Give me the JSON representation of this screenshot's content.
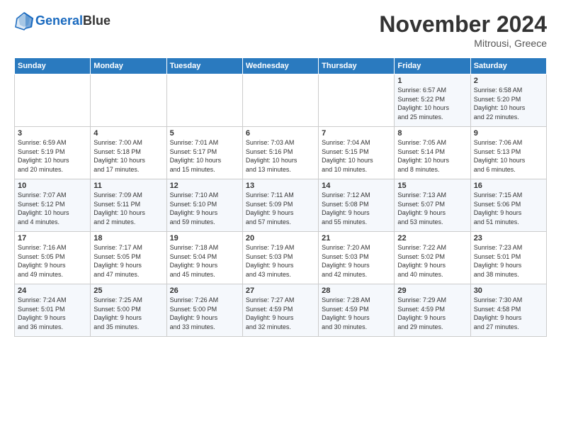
{
  "header": {
    "logo_line1": "General",
    "logo_line2": "Blue",
    "month": "November 2024",
    "location": "Mitrousi, Greece"
  },
  "weekdays": [
    "Sunday",
    "Monday",
    "Tuesday",
    "Wednesday",
    "Thursday",
    "Friday",
    "Saturday"
  ],
  "weeks": [
    [
      {
        "day": "",
        "info": ""
      },
      {
        "day": "",
        "info": ""
      },
      {
        "day": "",
        "info": ""
      },
      {
        "day": "",
        "info": ""
      },
      {
        "day": "",
        "info": ""
      },
      {
        "day": "1",
        "info": "Sunrise: 6:57 AM\nSunset: 5:22 PM\nDaylight: 10 hours\nand 25 minutes."
      },
      {
        "day": "2",
        "info": "Sunrise: 6:58 AM\nSunset: 5:20 PM\nDaylight: 10 hours\nand 22 minutes."
      }
    ],
    [
      {
        "day": "3",
        "info": "Sunrise: 6:59 AM\nSunset: 5:19 PM\nDaylight: 10 hours\nand 20 minutes."
      },
      {
        "day": "4",
        "info": "Sunrise: 7:00 AM\nSunset: 5:18 PM\nDaylight: 10 hours\nand 17 minutes."
      },
      {
        "day": "5",
        "info": "Sunrise: 7:01 AM\nSunset: 5:17 PM\nDaylight: 10 hours\nand 15 minutes."
      },
      {
        "day": "6",
        "info": "Sunrise: 7:03 AM\nSunset: 5:16 PM\nDaylight: 10 hours\nand 13 minutes."
      },
      {
        "day": "7",
        "info": "Sunrise: 7:04 AM\nSunset: 5:15 PM\nDaylight: 10 hours\nand 10 minutes."
      },
      {
        "day": "8",
        "info": "Sunrise: 7:05 AM\nSunset: 5:14 PM\nDaylight: 10 hours\nand 8 minutes."
      },
      {
        "day": "9",
        "info": "Sunrise: 7:06 AM\nSunset: 5:13 PM\nDaylight: 10 hours\nand 6 minutes."
      }
    ],
    [
      {
        "day": "10",
        "info": "Sunrise: 7:07 AM\nSunset: 5:12 PM\nDaylight: 10 hours\nand 4 minutes."
      },
      {
        "day": "11",
        "info": "Sunrise: 7:09 AM\nSunset: 5:11 PM\nDaylight: 10 hours\nand 2 minutes."
      },
      {
        "day": "12",
        "info": "Sunrise: 7:10 AM\nSunset: 5:10 PM\nDaylight: 9 hours\nand 59 minutes."
      },
      {
        "day": "13",
        "info": "Sunrise: 7:11 AM\nSunset: 5:09 PM\nDaylight: 9 hours\nand 57 minutes."
      },
      {
        "day": "14",
        "info": "Sunrise: 7:12 AM\nSunset: 5:08 PM\nDaylight: 9 hours\nand 55 minutes."
      },
      {
        "day": "15",
        "info": "Sunrise: 7:13 AM\nSunset: 5:07 PM\nDaylight: 9 hours\nand 53 minutes."
      },
      {
        "day": "16",
        "info": "Sunrise: 7:15 AM\nSunset: 5:06 PM\nDaylight: 9 hours\nand 51 minutes."
      }
    ],
    [
      {
        "day": "17",
        "info": "Sunrise: 7:16 AM\nSunset: 5:05 PM\nDaylight: 9 hours\nand 49 minutes."
      },
      {
        "day": "18",
        "info": "Sunrise: 7:17 AM\nSunset: 5:05 PM\nDaylight: 9 hours\nand 47 minutes."
      },
      {
        "day": "19",
        "info": "Sunrise: 7:18 AM\nSunset: 5:04 PM\nDaylight: 9 hours\nand 45 minutes."
      },
      {
        "day": "20",
        "info": "Sunrise: 7:19 AM\nSunset: 5:03 PM\nDaylight: 9 hours\nand 43 minutes."
      },
      {
        "day": "21",
        "info": "Sunrise: 7:20 AM\nSunset: 5:03 PM\nDaylight: 9 hours\nand 42 minutes."
      },
      {
        "day": "22",
        "info": "Sunrise: 7:22 AM\nSunset: 5:02 PM\nDaylight: 9 hours\nand 40 minutes."
      },
      {
        "day": "23",
        "info": "Sunrise: 7:23 AM\nSunset: 5:01 PM\nDaylight: 9 hours\nand 38 minutes."
      }
    ],
    [
      {
        "day": "24",
        "info": "Sunrise: 7:24 AM\nSunset: 5:01 PM\nDaylight: 9 hours\nand 36 minutes."
      },
      {
        "day": "25",
        "info": "Sunrise: 7:25 AM\nSunset: 5:00 PM\nDaylight: 9 hours\nand 35 minutes."
      },
      {
        "day": "26",
        "info": "Sunrise: 7:26 AM\nSunset: 5:00 PM\nDaylight: 9 hours\nand 33 minutes."
      },
      {
        "day": "27",
        "info": "Sunrise: 7:27 AM\nSunset: 4:59 PM\nDaylight: 9 hours\nand 32 minutes."
      },
      {
        "day": "28",
        "info": "Sunrise: 7:28 AM\nSunset: 4:59 PM\nDaylight: 9 hours\nand 30 minutes."
      },
      {
        "day": "29",
        "info": "Sunrise: 7:29 AM\nSunset: 4:59 PM\nDaylight: 9 hours\nand 29 minutes."
      },
      {
        "day": "30",
        "info": "Sunrise: 7:30 AM\nSunset: 4:58 PM\nDaylight: 9 hours\nand 27 minutes."
      }
    ]
  ]
}
